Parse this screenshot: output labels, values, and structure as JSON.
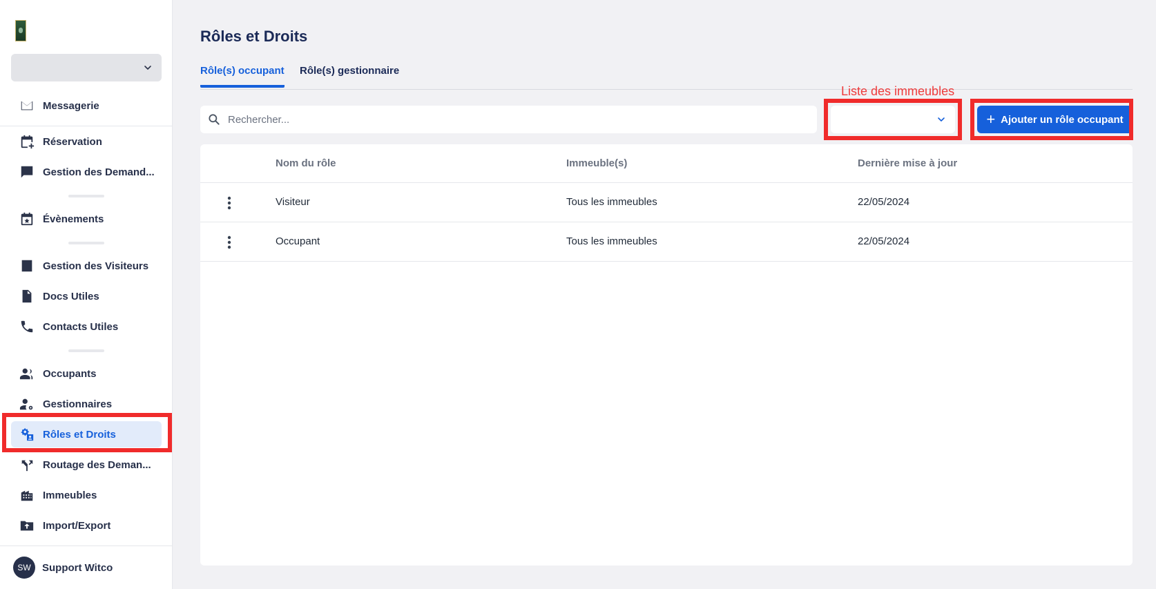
{
  "sidebar": {
    "org_select_value": "",
    "items": [
      {
        "label": "Messagerie",
        "icon": "mail-icon"
      },
      {
        "label": "Réservation",
        "icon": "calendar-add-icon"
      },
      {
        "label": "Gestion des Demand...",
        "icon": "chat-icon"
      },
      {
        "label": "Évènements",
        "icon": "calendar-star-icon"
      },
      {
        "label": "Gestion des Visiteurs",
        "icon": "badge-icon"
      },
      {
        "label": "Docs Utiles",
        "icon": "document-icon"
      },
      {
        "label": "Contacts Utiles",
        "icon": "phone-icon"
      },
      {
        "label": "Occupants",
        "icon": "people-icon"
      },
      {
        "label": "Gestionnaires",
        "icon": "user-gear-icon"
      },
      {
        "label": "Rôles et Droits",
        "icon": "roles-icon"
      },
      {
        "label": "Routage des Deman...",
        "icon": "routing-icon"
      },
      {
        "label": "Immeubles",
        "icon": "building-icon"
      },
      {
        "label": "Import/Export",
        "icon": "folder-upload-icon"
      }
    ],
    "active_item": "Rôles et Droits",
    "user": {
      "initials": "SW",
      "name": "Support Witco"
    }
  },
  "main": {
    "title": "Rôles et Droits",
    "tabs": [
      {
        "label": "Rôle(s) occupant",
        "active": true
      },
      {
        "label": "Rôle(s) gestionnaire",
        "active": false
      }
    ],
    "search": {
      "placeholder": "Rechercher...",
      "value": ""
    },
    "building_select": {
      "annotation": "Liste des immeubles",
      "value": ""
    },
    "add_button_label": "Ajouter un rôle occupant",
    "table": {
      "columns": [
        "Nom du rôle",
        "Immeuble(s)",
        "Dernière mise à jour"
      ],
      "rows": [
        {
          "name": "Visiteur",
          "buildings": "Tous les immeubles",
          "updated": "22/05/2024"
        },
        {
          "name": "Occupant",
          "buildings": "Tous les immeubles",
          "updated": "22/05/2024"
        }
      ]
    }
  },
  "colors": {
    "accent": "#1660db",
    "active_bg": "#e2ebfa",
    "annotation": "#f02b2b",
    "title": "#1b2a57"
  }
}
